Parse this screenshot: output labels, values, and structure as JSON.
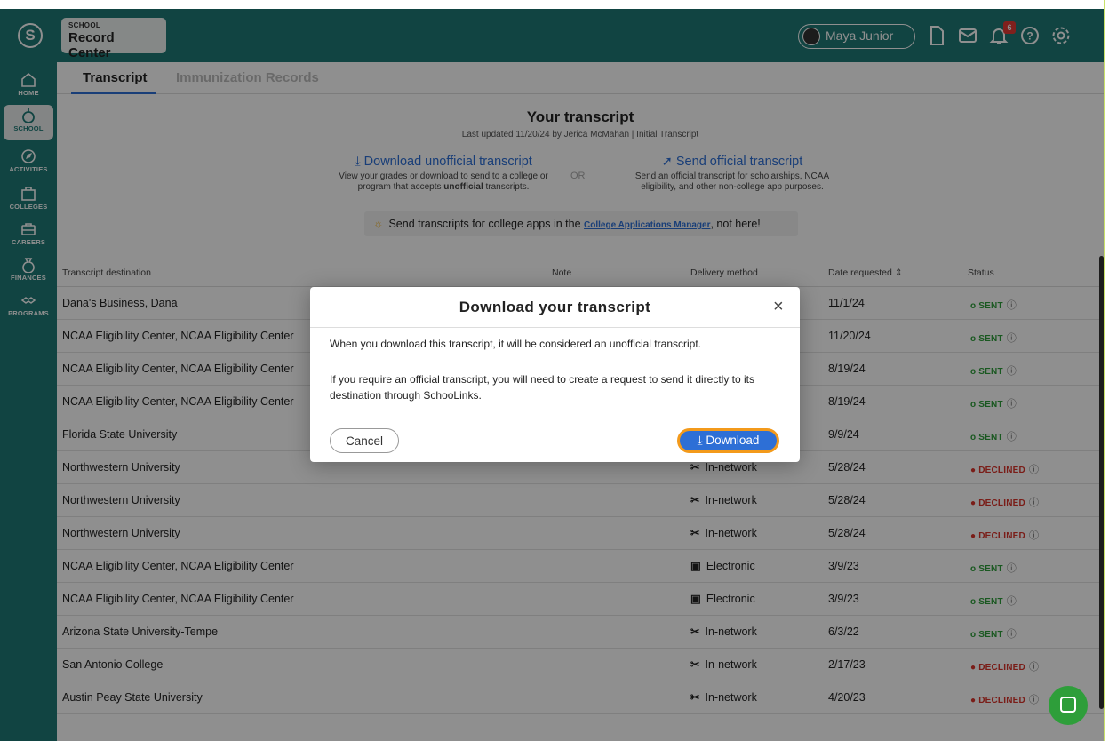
{
  "browser": {
    "title": ""
  },
  "header": {
    "logo_letter": "S",
    "section_small": "SCHOOL",
    "section_big": "Record Center",
    "user_name": "Maya Junior",
    "notification_count": "6"
  },
  "sidebar": {
    "items": [
      {
        "label": "HOME",
        "icon": "home-icon"
      },
      {
        "label": "SCHOOL",
        "icon": "apple-icon"
      },
      {
        "label": "ACTIVITIES",
        "icon": "compass-icon"
      },
      {
        "label": "COLLEGES",
        "icon": "building-icon"
      },
      {
        "label": "CAREERS",
        "icon": "briefcase-icon"
      },
      {
        "label": "FINANCES",
        "icon": "money-bag-icon"
      },
      {
        "label": "PROGRAMS",
        "icon": "handshake-icon"
      }
    ]
  },
  "tabs": [
    {
      "label": "Transcript"
    },
    {
      "label": "Immunization Records"
    }
  ],
  "hero": {
    "title": "Your transcript",
    "subtitle": "Last updated 11/20/24 by Jerica McMahan | Initial Transcript",
    "download_link": "Download unofficial transcript",
    "download_desc_1": "View your grades or download to send to a college or",
    "download_desc_2a": "program that accepts ",
    "download_desc_2b": "unofficial",
    "download_desc_2c": " transcripts.",
    "or": "OR",
    "send_link": "Send official transcript",
    "send_desc_1": "Send an official transcript for scholarships, NCAA",
    "send_desc_2": "eligibility, and other non-college app purposes.",
    "notice_pre": "Send transcripts for college apps in the ",
    "notice_link": "College Applications Manager",
    "notice_post": ", not here!"
  },
  "table": {
    "headers": {
      "destination": "Transcript destination",
      "note": "Note",
      "delivery": "Delivery method",
      "date": "Date requested ⇕",
      "status": "Status"
    },
    "rows": [
      {
        "destination": "Dana's Business, Dana",
        "delivery": "",
        "date": "11/1/24",
        "status": "SENT"
      },
      {
        "destination": "NCAA Eligibility Center, NCAA Eligibility Center",
        "delivery": "",
        "date": "11/20/24",
        "status": "SENT"
      },
      {
        "destination": "NCAA Eligibility Center, NCAA Eligibility Center",
        "delivery": "",
        "date": "8/19/24",
        "status": "SENT"
      },
      {
        "destination": "NCAA Eligibility Center, NCAA Eligibility Center",
        "delivery": "",
        "date": "8/19/24",
        "status": "SENT"
      },
      {
        "destination": "Florida State University",
        "delivery": "",
        "date": "9/9/24",
        "status": "SENT"
      },
      {
        "destination": "Northwestern University",
        "delivery": "In-network",
        "date": "5/28/24",
        "status": "DECLINED"
      },
      {
        "destination": "Northwestern University",
        "delivery": "In-network",
        "date": "5/28/24",
        "status": "DECLINED"
      },
      {
        "destination": "Northwestern University",
        "delivery": "In-network",
        "date": "5/28/24",
        "status": "DECLINED"
      },
      {
        "destination": "NCAA Eligibility Center, NCAA Eligibility Center",
        "delivery": "Electronic",
        "date": "3/9/23",
        "status": "SENT"
      },
      {
        "destination": "NCAA Eligibility Center, NCAA Eligibility Center",
        "delivery": "Electronic",
        "date": "3/9/23",
        "status": "SENT"
      },
      {
        "destination": "Arizona State University-Tempe",
        "delivery": "In-network",
        "date": "6/3/22",
        "status": "SENT"
      },
      {
        "destination": "San Antonio College",
        "delivery": "In-network",
        "date": "2/17/23",
        "status": "DECLINED"
      },
      {
        "destination": "Austin Peay State University",
        "delivery": "In-network",
        "date": "4/20/23",
        "status": "DECLINED"
      }
    ]
  },
  "modal": {
    "title": "Download your transcript",
    "close": "×",
    "p1": "When you download this transcript, it will be considered an unofficial transcript.",
    "p2": "If you require an official transcript, you will need to create a request to send it directly to its destination through SchooLinks.",
    "cancel": "Cancel",
    "download": "⤓ Download"
  },
  "colors": {
    "brand": "#1f7a76",
    "link": "#2d6fd6",
    "sent": "#2e9e3a",
    "declined": "#d9342b",
    "focus": "#f39a1b"
  }
}
